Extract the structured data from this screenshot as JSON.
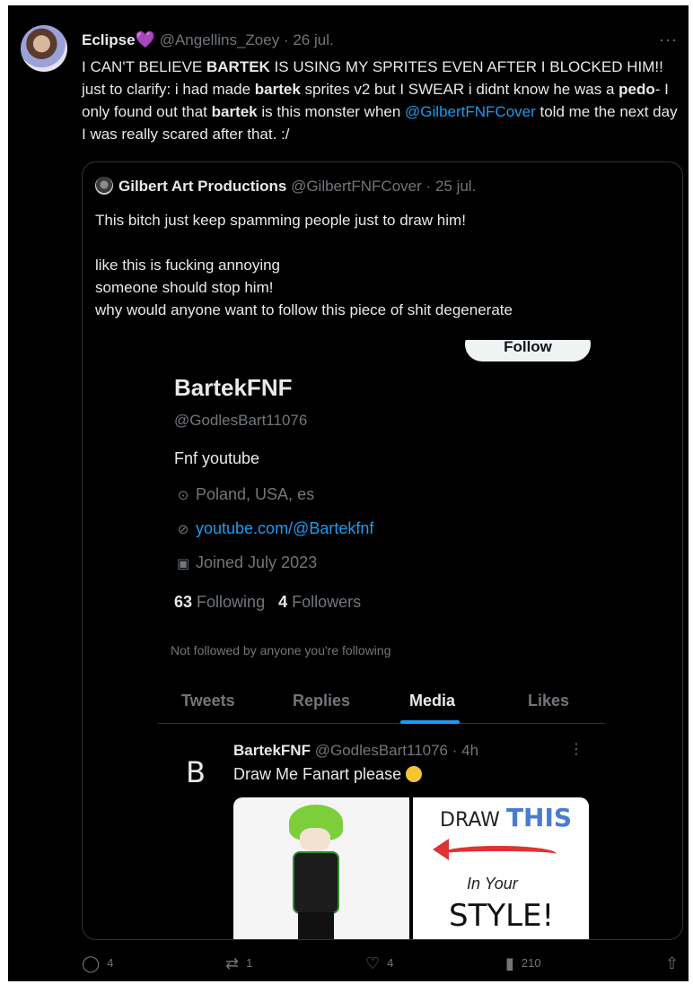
{
  "tweet": {
    "author_name": "Eclipse",
    "heart": "💜",
    "handle": "@Angellins_Zoey",
    "dot": "·",
    "date": "26 jul.",
    "more": "···",
    "text": {
      "l1a": "I CAN'T BELIEVE ",
      "l1b": "BARTEK",
      "l1c": " IS USING MY SPRITES EVEN AFTER I BLOCKED HIM!! just to clarify: i had made ",
      "l1d": "bartek",
      "l1e": " sprites v2 but I SWEAR i didnt know he was a ",
      "l1f": "pedo",
      "l1g": "- I only found out that ",
      "l1h": "bartek",
      "l1i": " is this monster when ",
      "mention": "@GilbertFNFCover",
      "l1j": " told me the next day I was really scared after that. :/"
    }
  },
  "quote": {
    "author_name": "Gilbert Art Productions",
    "handle": "@GilbertFNFCover",
    "dot": "·",
    "date": "25 jul.",
    "lines": [
      "This bitch just keep spamming people just to draw him!",
      "like this is fucking annoying",
      "someone should stop him!",
      "why would anyone want to follow this piece of shit degenerate"
    ]
  },
  "profile": {
    "follow_label": "Follow",
    "name": "BartekFNF",
    "handle": "@GodlesBart11076",
    "bio": "Fnf youtube",
    "location": "Poland, USA, es",
    "link": "youtube.com/@Bartekfnf",
    "joined": "Joined July 2023",
    "following_count": "63",
    "following_label": "Following",
    "followers_count": "4",
    "followers_label": "Followers",
    "note": "Not followed by anyone you're following",
    "tabs": [
      "Tweets",
      "Replies",
      "Media",
      "Likes"
    ],
    "active_tab": "Media"
  },
  "inner_tweet": {
    "logo": "B",
    "name": "BartekFNF",
    "handle": "@GodlesBart11076",
    "dot": "·",
    "time": "4h",
    "more": "⋮",
    "text": "Draw Me Fanart please",
    "image_right": {
      "draw": "DRAW",
      "this": "THIS",
      "in_your": "In Your",
      "style": "STYLE!"
    }
  },
  "actions": {
    "replies": "4",
    "retweets": "1",
    "likes": "4",
    "views": "210"
  },
  "colors": {
    "background": "#000000",
    "text": "#e7e9ea",
    "muted": "#71767b",
    "link": "#1d9bf0",
    "border": "#2f3336"
  }
}
